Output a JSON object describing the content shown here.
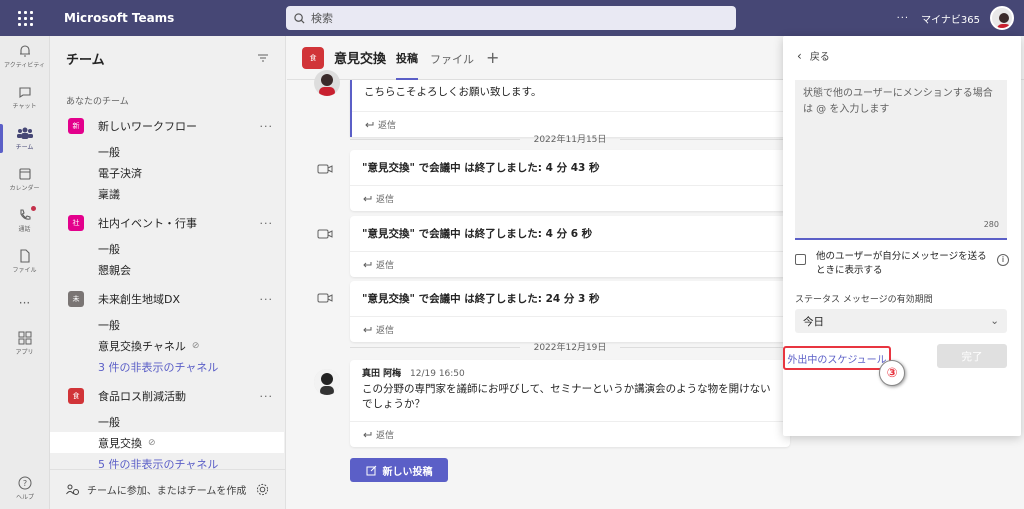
{
  "app": {
    "title": "Microsoft Teams",
    "search_placeholder": "検索",
    "more": "···",
    "org": "マイナビ365"
  },
  "rail": [
    {
      "label": "アクティビティ",
      "icon": "bell-icon"
    },
    {
      "label": "チャット",
      "icon": "chat-icon"
    },
    {
      "label": "チーム",
      "icon": "teams-icon",
      "active": true
    },
    {
      "label": "カレンダー",
      "icon": "calendar-icon"
    },
    {
      "label": "通話",
      "icon": "phone-icon"
    },
    {
      "label": "ファイル",
      "icon": "file-icon"
    },
    {
      "label": "···",
      "icon": "more-icon"
    },
    {
      "label": "アプリ",
      "icon": "apps-icon"
    },
    {
      "label": "ヘルプ",
      "icon": "help-icon"
    }
  ],
  "sidebar": {
    "title": "チーム",
    "section": "あなたのチーム",
    "teams": [
      {
        "badge": "新",
        "name": "新しいワークフロー",
        "color": "#e3008c",
        "channels": [
          "一般",
          "電子決済",
          "稟議"
        ]
      },
      {
        "badge": "社",
        "name": "社内イベント・行事",
        "color": "#e3008c",
        "channels": [
          "一般",
          "懇親会"
        ]
      },
      {
        "badge": "未",
        "name": "未来創生地域DX",
        "color": "#7a7574",
        "channels": [
          "一般",
          "意見交換チャネル"
        ],
        "hidden": "3 件の非表示のチャネル"
      },
      {
        "badge": "食",
        "name": "食品ロス削減活動",
        "color": "#d13438",
        "channels": [
          "一般",
          "意見交換"
        ],
        "hidden": "5 件の非表示のチャネル"
      }
    ],
    "footer": "チームに参加、またはチームを作成"
  },
  "main": {
    "badge": "食",
    "title": "意見交換",
    "tabs": [
      "投稿",
      "ファイル"
    ],
    "add_tab": "+",
    "reply": "返信",
    "posts": [
      {
        "text": "こちらこそよろしくお願い致します。"
      },
      {
        "text": "\"意見交換\" で会議中 は終了しました: 4 分 43 秒"
      },
      {
        "text": "\"意見交換\" で会議中 は終了しました: 4 分 6 秒"
      },
      {
        "text": "\"意見交換\" で会議中 は終了しました: 24 分 3 秒"
      },
      {
        "author": "真田 阿梅",
        "time": "12/19 16:50",
        "text": "この分野の専門家を議師にお呼びして、セミナーというか講演会のような物を開けないでしょうか？"
      }
    ],
    "dates": [
      "2022年11月15日",
      "2022年12月19日"
    ],
    "new_post": "新しい投稿"
  },
  "panel": {
    "back": "戻る",
    "placeholder": "状態で他のユーザーにメンションする場合は @ を入力します",
    "count": "280",
    "checkbox_label": "他のユーザーが自分にメッセージを送るときに表示する",
    "info": "i",
    "duration_label": "ステータス メッセージの有効期間",
    "duration_value": "今日",
    "ooo_link": "外出中のスケジュール",
    "done": "完了",
    "callout": "③"
  },
  "colors": {
    "accent": "#5b5fc7",
    "topbar": "#464775",
    "highlight": "#e83540"
  }
}
